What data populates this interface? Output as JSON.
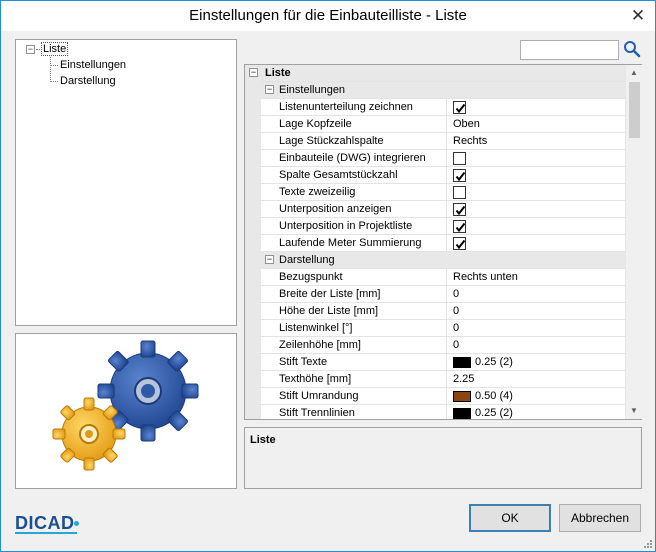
{
  "window": {
    "title": "Einstellungen für die Einbauteilliste - Liste",
    "close_label": "✕"
  },
  "tree": {
    "root": {
      "label": "Liste",
      "expander": "−"
    },
    "children": [
      {
        "label": "Einstellungen"
      },
      {
        "label": "Darstellung"
      }
    ]
  },
  "search": {
    "value": "",
    "placeholder": "",
    "icon": "magnifier-icon"
  },
  "grid": {
    "root_category": {
      "label": "Liste",
      "expander": "−"
    },
    "categories": [
      {
        "label": "Einstellungen",
        "expander": "−",
        "rows": [
          {
            "name": "Listenunterteilung zeichnen",
            "type": "checkbox",
            "checked": true
          },
          {
            "name": "Lage Kopfzeile",
            "type": "text",
            "value": "Oben"
          },
          {
            "name": "Lage Stückzahlspalte",
            "type": "text",
            "value": "Rechts"
          },
          {
            "name": "Einbauteile (DWG) integrieren",
            "type": "checkbox",
            "checked": false
          },
          {
            "name": "Spalte Gesamtstückzahl",
            "type": "checkbox",
            "checked": true
          },
          {
            "name": "Texte zweizeilig",
            "type": "checkbox",
            "checked": false
          },
          {
            "name": "Unterposition anzeigen",
            "type": "checkbox",
            "checked": true
          },
          {
            "name": "Unterposition in Projektliste",
            "type": "checkbox",
            "checked": true
          },
          {
            "name": "Laufende Meter Summierung",
            "type": "checkbox",
            "checked": true
          }
        ]
      },
      {
        "label": "Darstellung",
        "expander": "−",
        "rows": [
          {
            "name": "Bezugspunkt",
            "type": "text",
            "value": "Rechts unten"
          },
          {
            "name": "Breite der Liste [mm]",
            "type": "text",
            "value": "0"
          },
          {
            "name": "Höhe der Liste [mm]",
            "type": "text",
            "value": "0"
          },
          {
            "name": "Listenwinkel [°]",
            "type": "text",
            "value": "0"
          },
          {
            "name": "Zeilenhöhe [mm]",
            "type": "text",
            "value": "0"
          },
          {
            "name": "Stift Texte",
            "type": "pen",
            "value": "0.25 (2)",
            "color": "#000000"
          },
          {
            "name": "Texthöhe [mm]",
            "type": "text",
            "value": "2.25"
          },
          {
            "name": "Stift Umrandung",
            "type": "pen",
            "value": "0.50 (4)",
            "color": "#8b4513"
          },
          {
            "name": "Stift Trennlinien",
            "type": "pen",
            "value": "0.25 (2)",
            "color": "#000000"
          }
        ]
      }
    ]
  },
  "description": {
    "title": "Liste"
  },
  "buttons": {
    "ok": "OK",
    "cancel": "Abbrechen"
  },
  "logo": {
    "text": "DICAD"
  },
  "colors": {
    "accent": "#1f8fd6",
    "gear_blue": "#2f5aa8",
    "gear_yellow": "#f2b82e",
    "logo_blue": "#1d4e8f"
  }
}
